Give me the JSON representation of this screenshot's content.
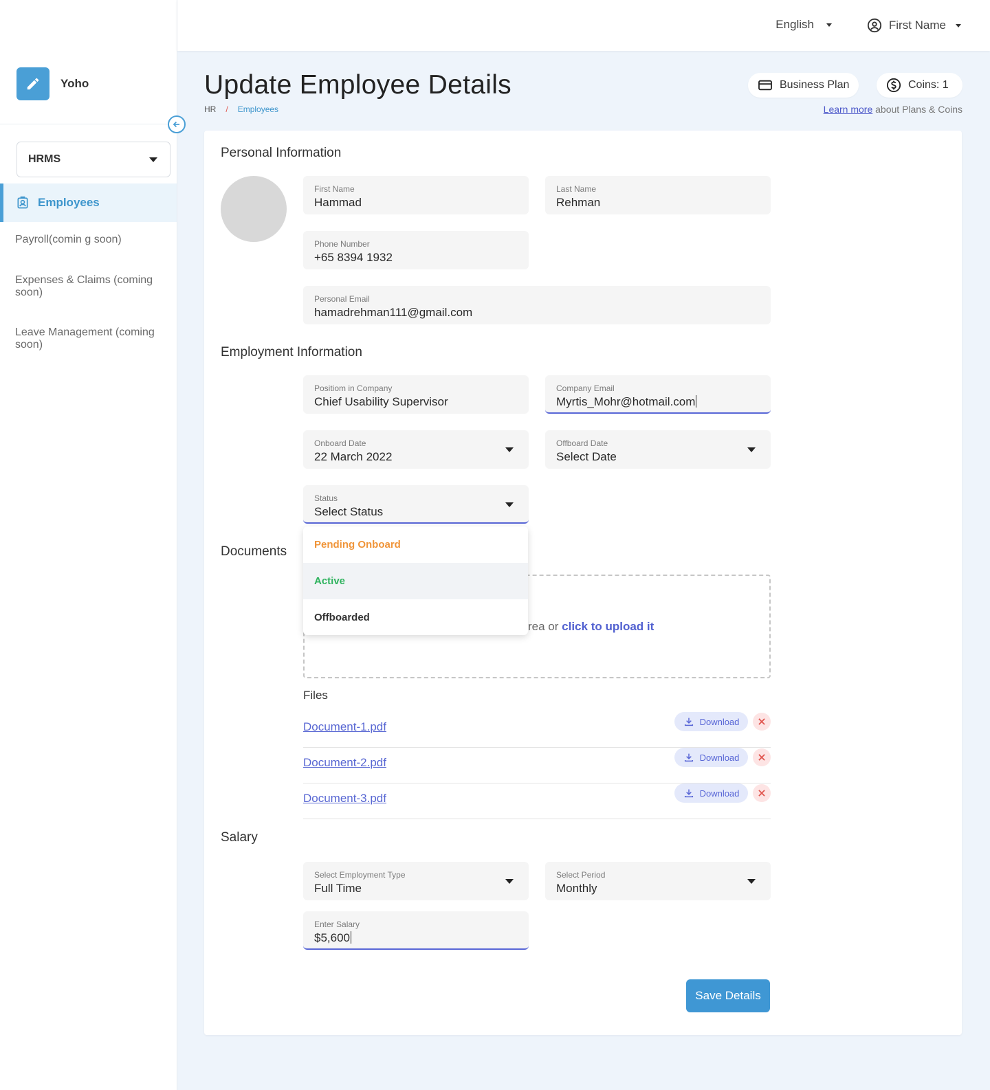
{
  "app": {
    "name": "Yoho"
  },
  "sidebar": {
    "module": "HRMS",
    "active": "Employees",
    "items": [
      {
        "label": "Payroll(comin g soon)"
      },
      {
        "label": "Expenses & Claims (coming soon)"
      },
      {
        "label": "Leave Management (coming soon)"
      }
    ]
  },
  "topbar": {
    "language": "English",
    "user": "First Name"
  },
  "header": {
    "title": "Update Employee Details",
    "breadcrumb": {
      "root": "HR",
      "sep": "/",
      "current": "Employees"
    },
    "plan": "Business Plan",
    "coins": "Coins: 1",
    "learn_link": "Learn more",
    "learn_rest": "about Plans & Coins"
  },
  "personal": {
    "title": "Personal Information",
    "first_name": {
      "label": "First Name",
      "value": "Hammad"
    },
    "last_name": {
      "label": "Last Name",
      "value": "Rehman"
    },
    "phone": {
      "label": "Phone Number",
      "value": "+65 8394 1932"
    },
    "email": {
      "label": "Personal Email",
      "value": "hamadrehman111@gmail.com"
    }
  },
  "employment": {
    "title": "Employment Information",
    "position": {
      "label": "Positiom in Company",
      "value": "Chief Usability Supervisor"
    },
    "company_email": {
      "label": "Company Email",
      "value": "Myrtis_Mohr@hotmail.com"
    },
    "onboard": {
      "label": "Onboard Date",
      "value": "22 March 2022"
    },
    "offboard": {
      "label": "Offboard Date",
      "value": "Select Date"
    },
    "status": {
      "label": "Status",
      "value": "Select Status"
    },
    "status_options": [
      {
        "label": "Pending Onboard",
        "color": "#f0953a"
      },
      {
        "label": "Active",
        "color": "#2fb35e"
      },
      {
        "label": "Offboarded",
        "color": "#333333"
      }
    ]
  },
  "documents": {
    "title": "Documents",
    "drop_text": "rea or",
    "upload_link": "click to upload it",
    "files_title": "Files",
    "download_label": "Download",
    "files": [
      {
        "name": "Document-1.pdf"
      },
      {
        "name": "Document-2.pdf"
      },
      {
        "name": "Document-3.pdf"
      }
    ]
  },
  "salary": {
    "title": "Salary",
    "type": {
      "label": "Select Employment Type",
      "value": "Full Time"
    },
    "period": {
      "label": "Select Period",
      "value": "Monthly"
    },
    "amount": {
      "label": "Enter Salary",
      "value": "$5,600"
    }
  },
  "actions": {
    "save": "Save Details"
  },
  "colors": {
    "accent": "#3f97d4",
    "link": "#5866d6",
    "danger": "#e0554e"
  }
}
